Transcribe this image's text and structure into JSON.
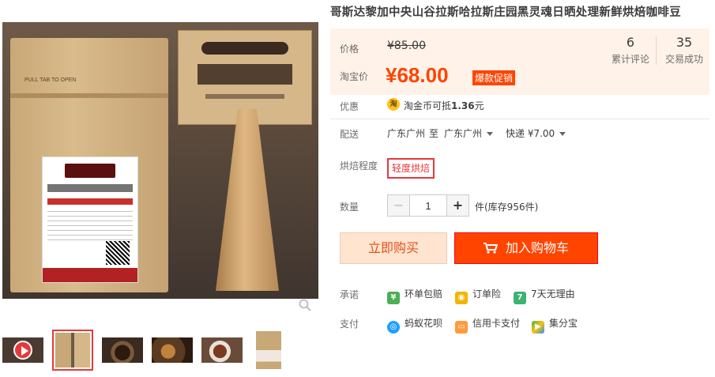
{
  "product": {
    "title": "哥斯达黎加中央山谷拉斯哈拉斯庄园黑灵魂日晒处理新鲜烘焙咖啡豆"
  },
  "price": {
    "original_label": "价格",
    "original_value": "¥85.00",
    "taobao_label": "淘宝价",
    "taobao_value": "¥68.00",
    "promo_badge": "爆款促销"
  },
  "stats": [
    {
      "num": "6",
      "label": "累计评论"
    },
    {
      "num": "35",
      "label": "交易成功"
    }
  ],
  "discount": {
    "label": "优惠",
    "icon_glyph": "淘",
    "text_prefix": "淘金币可抵",
    "text_amount": "1.36",
    "text_suffix": "元"
  },
  "shipping": {
    "label": "配送",
    "from": "广东广州",
    "to_word": "至",
    "to": "广东广州",
    "method": "快递 ¥7.00"
  },
  "roast": {
    "label": "烘焙程度",
    "option": "轻度烘焙"
  },
  "quantity": {
    "label": "数量",
    "minus": "−",
    "value": "1",
    "plus": "+",
    "stock": "件(库存956件)"
  },
  "actions": {
    "buy_now": "立即购买",
    "add_to_cart": "加入购物车"
  },
  "promises": {
    "label": "承诺",
    "items": [
      "环单包赔",
      "订单险",
      "7天无理由"
    ]
  },
  "payment": {
    "label": "支付",
    "items": [
      "蚂蚁花呗",
      "信用卡支付",
      "集分宝"
    ]
  },
  "colors": {
    "accent": "#ff4400",
    "price_bg": "#fff2e8",
    "selected_border": "#e4393c"
  }
}
